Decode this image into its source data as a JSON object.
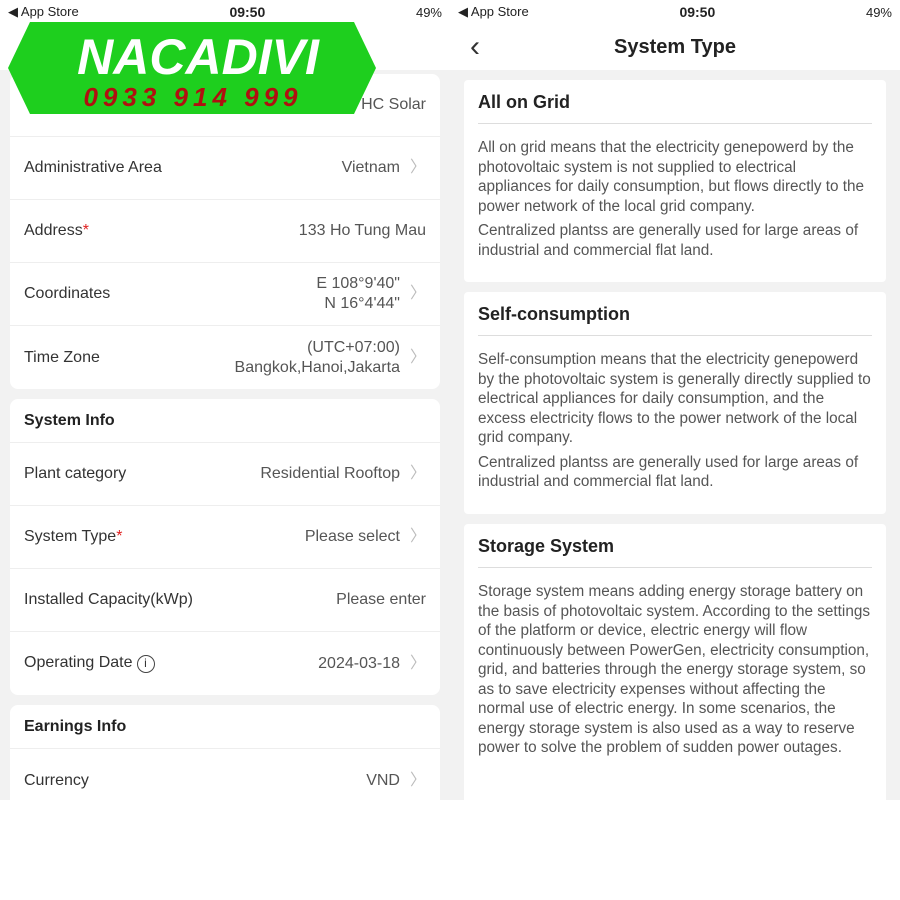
{
  "status_bar": {
    "back_app": "◀ App Store",
    "time": "09:50",
    "battery": "49%"
  },
  "logo": {
    "brand": "NACADIVI",
    "phone": "0933 914 999",
    "color": "#1ecf1e"
  },
  "left": {
    "card1": {
      "rows": [
        {
          "label": "",
          "value": "HC Solar"
        },
        {
          "label": "Administrative Area",
          "value": "Vietnam"
        },
        {
          "label": "Address",
          "value": "133 Ho Tung Mau",
          "required": "*"
        },
        {
          "label": "Coordinates",
          "value": "E 108°9'40\"",
          "value2": "N 16°4'44\""
        },
        {
          "label": "Time Zone",
          "value": "(UTC+07:00)",
          "value2": "Bangkok,Hanoi,Jakarta"
        }
      ]
    },
    "system_info": {
      "title": "System Info",
      "rows": [
        {
          "label": "Plant category",
          "value": "Residential Rooftop"
        },
        {
          "label": "System Type",
          "required": "*",
          "value": "Please select"
        },
        {
          "label": "Installed Capacity(kWp)",
          "placeholder": "Please enter"
        },
        {
          "label": "Operating Date",
          "value": "2024-03-18"
        }
      ]
    },
    "earnings_info": {
      "title": "Earnings Info",
      "rows": [
        {
          "label": "Currency",
          "value": "VND"
        }
      ]
    }
  },
  "right": {
    "title": "System Type",
    "options": [
      {
        "title": "All on Grid",
        "p1": "All on grid means that the electricity genepowerd by the photovoltaic system is not supplied to electrical appliances for daily consumption, but flows directly to the power network of the local grid company.",
        "p2": "Centralized plantss are generally used for large areas of industrial and commercial flat land."
      },
      {
        "title": "Self-consumption",
        "p1": "Self-consumption means that the electricity genepowerd by the photovoltaic system is generally directly supplied to electrical appliances for daily consumption, and the excess electricity flows to the power network of the local grid company.",
        "p2": "Centralized plantss are generally used for large areas of industrial and commercial flat land."
      },
      {
        "title": "Storage System",
        "p1": "Storage system means adding energy storage battery on the basis of photovoltaic system. According to the settings of the platform or device, electric energy will flow continuously between PowerGen, electricity consumption, grid, and batteries through the energy storage system, so as to save electricity expenses without affecting the normal use of electric energy. In some scenarios, the energy storage system is also used as a way to reserve power to solve the problem of sudden power outages."
      }
    ]
  }
}
